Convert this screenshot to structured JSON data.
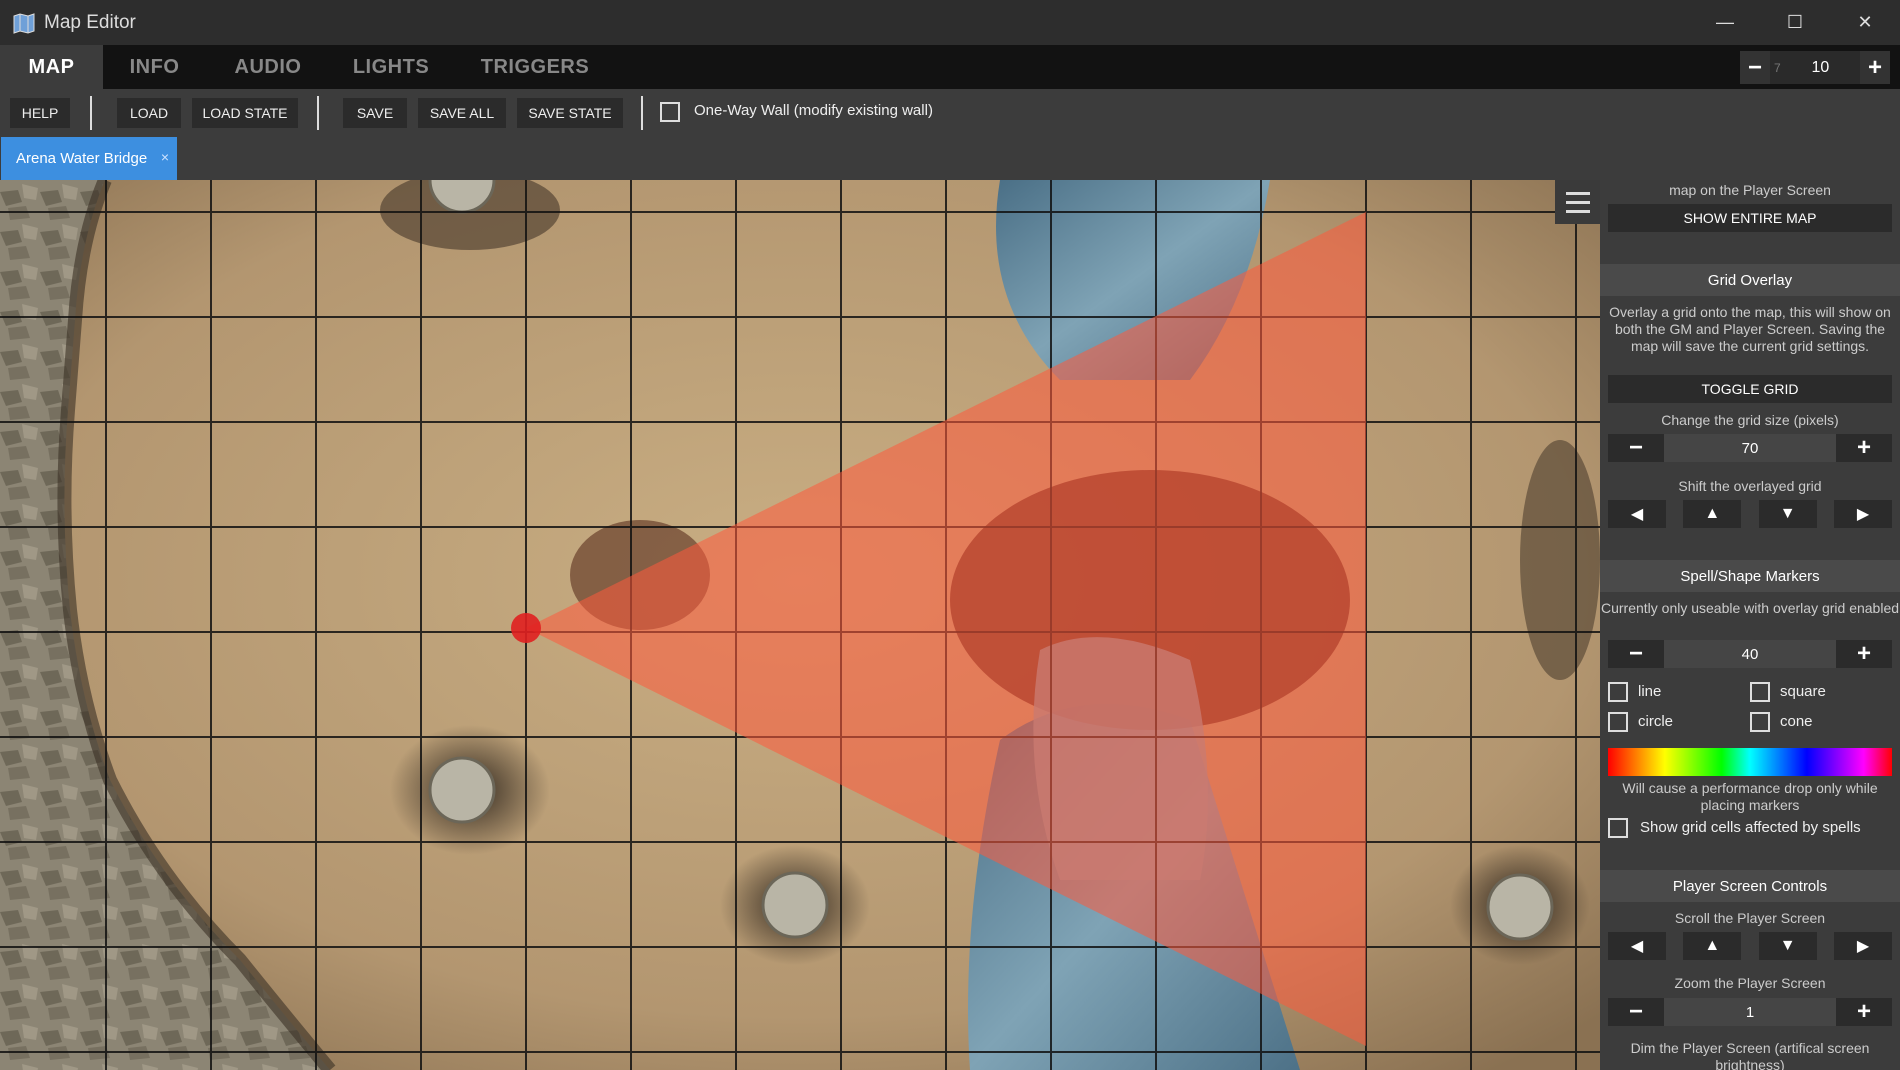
{
  "window": {
    "title": "Map Editor",
    "minimize_glyph": "—",
    "maximize_glyph": "☐",
    "close_glyph": "✕"
  },
  "tabs": [
    {
      "label": "MAP",
      "active": true
    },
    {
      "label": "INFO",
      "active": false
    },
    {
      "label": "AUDIO",
      "active": false
    },
    {
      "label": "LIGHTS",
      "active": false
    },
    {
      "label": "TRIGGERS",
      "active": false
    }
  ],
  "zoom": {
    "minus": "−",
    "min_hint": "7",
    "value": "10",
    "plus": "+"
  },
  "toolbar": {
    "help": "HELP",
    "load": "LOAD",
    "load_state": "LOAD STATE",
    "save": "SAVE",
    "save_all": "SAVE ALL",
    "save_state": "SAVE STATE",
    "one_way_wall_label": "One-Way Wall (modify existing wall)",
    "one_way_wall_checked": false
  },
  "documents": [
    {
      "label": "Arena Water Bridge",
      "close": "×",
      "active": true
    }
  ],
  "map": {
    "name": "Arena Water Bridge",
    "grid_visible": true,
    "cone_marker_color": "#ff5a3c",
    "origin_marker_color": "#e02020"
  },
  "panel": {
    "show_map_text": "map on the Player Screen",
    "show_entire_map": "SHOW ENTIRE MAP",
    "grid_overlay": {
      "title": "Grid Overlay",
      "description": "Overlay a grid onto the map, this will show on both the GM and Player Screen. Saving the map will save the current grid settings.",
      "toggle_label": "TOGGLE GRID",
      "size_label": "Change the grid size (pixels)",
      "size_value": "70",
      "shift_label": "Shift the overlayed grid"
    },
    "spell_markers": {
      "title": "Spell/Shape Markers",
      "note": "Currently only useable with overlay grid enabled",
      "size_value": "40",
      "shapes": [
        {
          "label": "line",
          "checked": false
        },
        {
          "label": "square",
          "checked": false
        },
        {
          "label": "circle",
          "checked": false
        },
        {
          "label": "cone",
          "checked": false
        }
      ],
      "perf_note": "Will cause a performance drop only while placing markers",
      "show_cells_label": "Show grid cells affected by spells",
      "show_cells_checked": false
    },
    "player_screen": {
      "title": "Player Screen Controls",
      "scroll_label": "Scroll the Player Screen",
      "zoom_label": "Zoom the Player Screen",
      "zoom_value": "1",
      "dim_label": "Dim the Player Screen (artifical screen brightness)"
    },
    "glyphs": {
      "minus": "−",
      "plus": "+",
      "left": "◀",
      "up": "▲",
      "down": "▼",
      "right": "▶"
    }
  },
  "colors": {
    "accent_tab": "#3d8fe0",
    "toolbar_bg": "#3c3c3c",
    "tabbar_bg": "#121212"
  }
}
